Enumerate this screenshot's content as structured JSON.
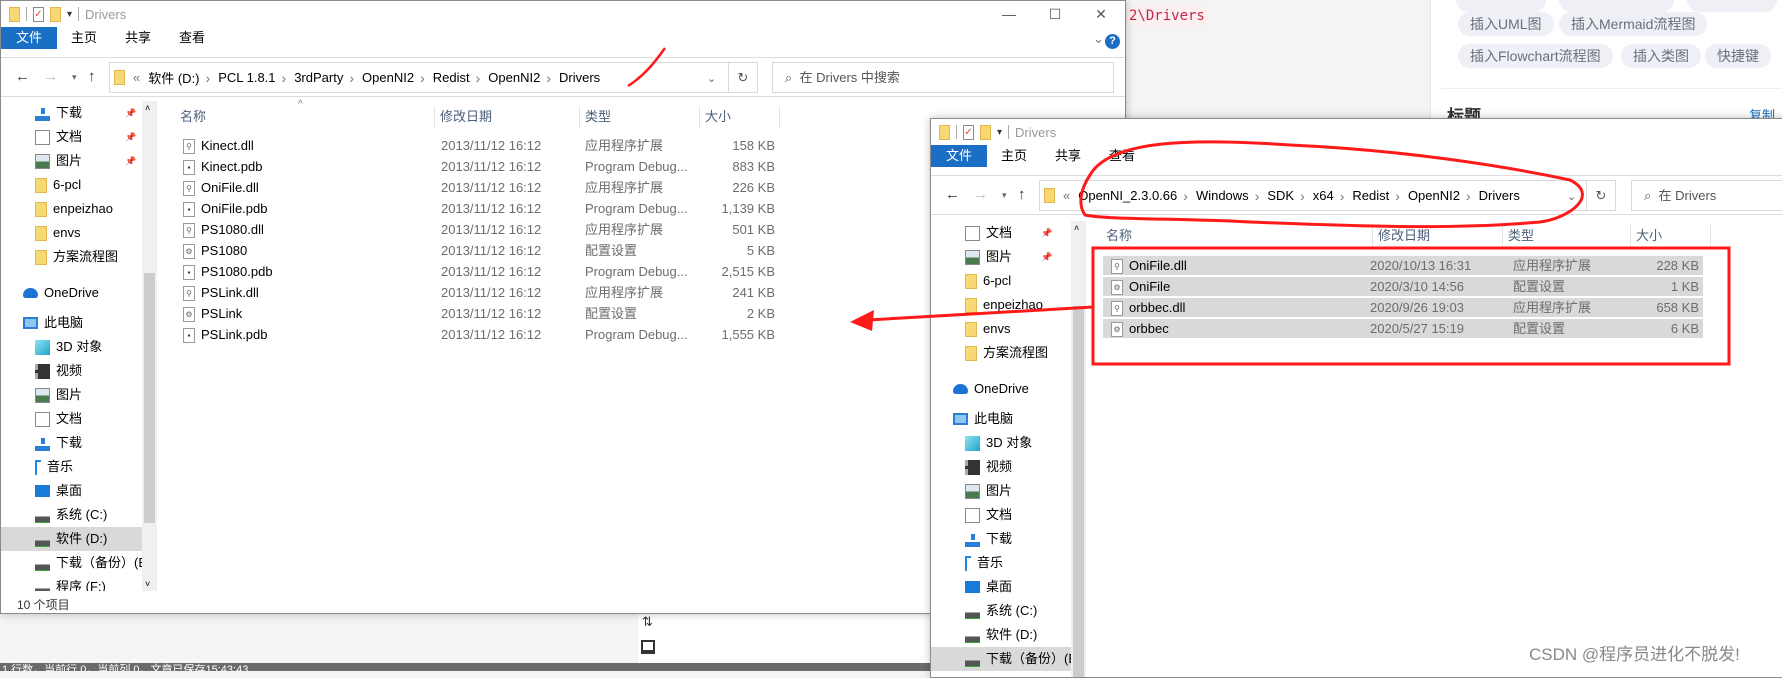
{
  "background": {
    "code_snippet": "2\\Drivers",
    "pills_row1": [
      "插入UML图",
      "插入Mermaid流程图"
    ],
    "pills_row2": [
      "插入Flowchart流程图",
      "插入类图",
      "快捷键"
    ],
    "section_title": "标题",
    "copy_link": "复制",
    "status_bar": "1 行数，当前行 0，当前列 0，文章已保存15:43:43",
    "watermark": "CSDN @程序员进化不脱发!"
  },
  "window1": {
    "title": "Drivers",
    "ribbon_tabs": [
      "文件",
      "主页",
      "共享",
      "查看"
    ],
    "breadcrumb": [
      "软件 (D:)",
      "PCL 1.8.1",
      "3rdParty",
      "OpenNI2",
      "Redist",
      "OpenNI2",
      "Drivers"
    ],
    "search_placeholder": "在 Drivers 中搜索",
    "columns": [
      "名称",
      "修改日期",
      "类型",
      "大小"
    ],
    "nav_items": [
      {
        "label": "下载",
        "icon": "download-icon",
        "pinned": true
      },
      {
        "label": "文档",
        "icon": "document-icon",
        "pinned": true
      },
      {
        "label": "图片",
        "icon": "picture-icon",
        "pinned": true
      },
      {
        "label": "6-pcl",
        "icon": "folder-icon"
      },
      {
        "label": "enpeizhao",
        "icon": "folder-icon"
      },
      {
        "label": "envs",
        "icon": "folder-icon"
      },
      {
        "label": "方案流程图",
        "icon": "folder-icon"
      },
      {
        "label": "OneDrive",
        "icon": "cloud-icon",
        "top": true
      },
      {
        "label": "此电脑",
        "icon": "computer-icon",
        "top": true
      },
      {
        "label": "3D 对象",
        "icon": "cube-icon"
      },
      {
        "label": "视频",
        "icon": "video-icon"
      },
      {
        "label": "图片",
        "icon": "picture-icon"
      },
      {
        "label": "文档",
        "icon": "document-icon"
      },
      {
        "label": "下载",
        "icon": "download-icon"
      },
      {
        "label": "音乐",
        "icon": "music-icon"
      },
      {
        "label": "桌面",
        "icon": "desktop-icon"
      },
      {
        "label": "系统 (C:)",
        "icon": "drive-icon"
      },
      {
        "label": "软件 (D:)",
        "icon": "drive-icon",
        "selected": true
      },
      {
        "label": "下载（备份）(E",
        "icon": "drive-icon"
      },
      {
        "label": "程序 (F:)",
        "icon": "drive-icon"
      }
    ],
    "files": [
      {
        "name": "Kinect.dll",
        "date": "2013/11/12 16:12",
        "type": "应用程序扩展",
        "size": "158 KB",
        "icon": "dll-file-icon"
      },
      {
        "name": "Kinect.pdb",
        "date": "2013/11/12 16:12",
        "type": "Program Debug...",
        "size": "883 KB",
        "icon": "pdb-file-icon"
      },
      {
        "name": "OniFile.dll",
        "date": "2013/11/12 16:12",
        "type": "应用程序扩展",
        "size": "226 KB",
        "icon": "dll-file-icon"
      },
      {
        "name": "OniFile.pdb",
        "date": "2013/11/12 16:12",
        "type": "Program Debug...",
        "size": "1,139 KB",
        "icon": "pdb-file-icon"
      },
      {
        "name": "PS1080.dll",
        "date": "2013/11/12 16:12",
        "type": "应用程序扩展",
        "size": "501 KB",
        "icon": "dll-file-icon"
      },
      {
        "name": "PS1080",
        "date": "2013/11/12 16:12",
        "type": "配置设置",
        "size": "5 KB",
        "icon": "ini-file-icon"
      },
      {
        "name": "PS1080.pdb",
        "date": "2013/11/12 16:12",
        "type": "Program Debug...",
        "size": "2,515 KB",
        "icon": "pdb-file-icon"
      },
      {
        "name": "PSLink.dll",
        "date": "2013/11/12 16:12",
        "type": "应用程序扩展",
        "size": "241 KB",
        "icon": "dll-file-icon"
      },
      {
        "name": "PSLink",
        "date": "2013/11/12 16:12",
        "type": "配置设置",
        "size": "2 KB",
        "icon": "ini-file-icon"
      },
      {
        "name": "PSLink.pdb",
        "date": "2013/11/12 16:12",
        "type": "Program Debug...",
        "size": "1,555 KB",
        "icon": "pdb-file-icon"
      }
    ],
    "status": "10 个项目"
  },
  "window2": {
    "title": "Drivers",
    "ribbon_tabs": [
      "文件",
      "主页",
      "共享",
      "查看"
    ],
    "breadcrumb": [
      "OpenNI_2.3.0.66",
      "Windows",
      "SDK",
      "x64",
      "Redist",
      "OpenNI2",
      "Drivers"
    ],
    "search_placeholder": "在 Drivers",
    "columns": [
      "名称",
      "修改日期",
      "类型",
      "大小"
    ],
    "nav_items": [
      {
        "label": "文档",
        "icon": "document-icon",
        "pinned": true
      },
      {
        "label": "图片",
        "icon": "picture-icon",
        "pinned": true
      },
      {
        "label": "6-pcl",
        "icon": "folder-icon"
      },
      {
        "label": "enpeizhao",
        "icon": "folder-icon"
      },
      {
        "label": "envs",
        "icon": "folder-icon"
      },
      {
        "label": "方案流程图",
        "icon": "folder-icon"
      },
      {
        "label": "OneDrive",
        "icon": "cloud-icon",
        "top": true
      },
      {
        "label": "此电脑",
        "icon": "computer-icon",
        "top": true
      },
      {
        "label": "3D 对象",
        "icon": "cube-icon"
      },
      {
        "label": "视频",
        "icon": "video-icon"
      },
      {
        "label": "图片",
        "icon": "picture-icon"
      },
      {
        "label": "文档",
        "icon": "document-icon"
      },
      {
        "label": "下载",
        "icon": "download-icon"
      },
      {
        "label": "音乐",
        "icon": "music-icon"
      },
      {
        "label": "桌面",
        "icon": "desktop-icon"
      },
      {
        "label": "系统 (C:)",
        "icon": "drive-icon"
      },
      {
        "label": "软件 (D:)",
        "icon": "drive-icon"
      },
      {
        "label": "下载（备份）(E",
        "icon": "drive-icon",
        "selected": true
      }
    ],
    "files": [
      {
        "name": "OniFile.dll",
        "date": "2020/10/13 16:31",
        "type": "应用程序扩展",
        "size": "228 KB",
        "icon": "dll-file-icon"
      },
      {
        "name": "OniFile",
        "date": "2020/3/10 14:56",
        "type": "配置设置",
        "size": "1 KB",
        "icon": "ini-file-icon"
      },
      {
        "name": "orbbec.dll",
        "date": "2020/9/26 19:03",
        "type": "应用程序扩展",
        "size": "658 KB",
        "icon": "dll-file-icon"
      },
      {
        "name": "orbbec",
        "date": "2020/5/27 15:19",
        "type": "配置设置",
        "size": "6 KB",
        "icon": "ini-file-icon"
      }
    ]
  },
  "colors": {
    "accent": "#1a6fc4",
    "annotation": "#ff1a1a",
    "selection": "#d9d9d9"
  }
}
